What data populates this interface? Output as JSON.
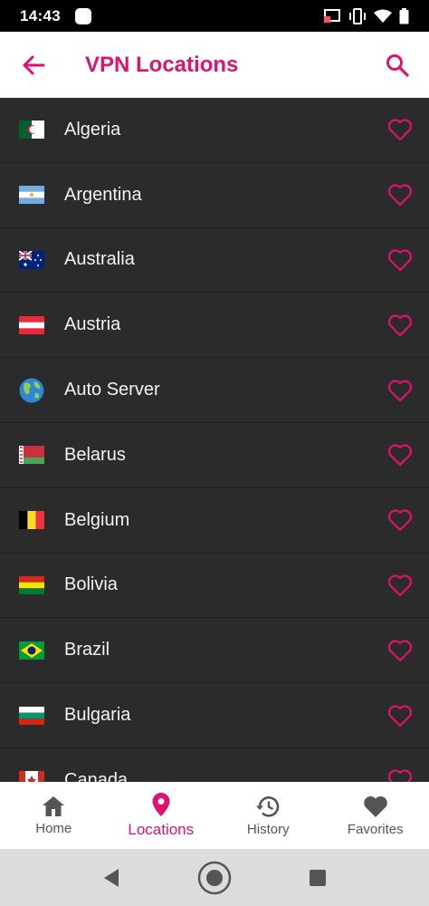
{
  "status_bar": {
    "time": "14:43"
  },
  "app_bar": {
    "title": "VPN Locations"
  },
  "locations": [
    {
      "name": "Algeria",
      "flag": "algeria-flag"
    },
    {
      "name": "Argentina",
      "flag": "argentina-flag"
    },
    {
      "name": "Australia",
      "flag": "australia-flag"
    },
    {
      "name": "Austria",
      "flag": "austria-flag"
    },
    {
      "name": "Auto Server",
      "flag": "globe-icon"
    },
    {
      "name": "Belarus",
      "flag": "belarus-flag"
    },
    {
      "name": "Belgium",
      "flag": "belgium-flag"
    },
    {
      "name": "Bolivia",
      "flag": "bolivia-flag"
    },
    {
      "name": "Brazil",
      "flag": "brazil-flag"
    },
    {
      "name": "Bulgaria",
      "flag": "bulgaria-flag"
    },
    {
      "name": "Canada",
      "flag": "canada-flag"
    }
  ],
  "bottom_nav": {
    "items": [
      {
        "label": "Home",
        "icon": "home-icon"
      },
      {
        "label": "Locations",
        "icon": "location-pin-icon",
        "active": true
      },
      {
        "label": "History",
        "icon": "history-icon"
      },
      {
        "label": "Favorites",
        "icon": "heart-icon"
      }
    ]
  },
  "colors": {
    "accent": "#e0116f",
    "list_bg": "#2b2b2b",
    "header_bg": "#ffffff"
  }
}
